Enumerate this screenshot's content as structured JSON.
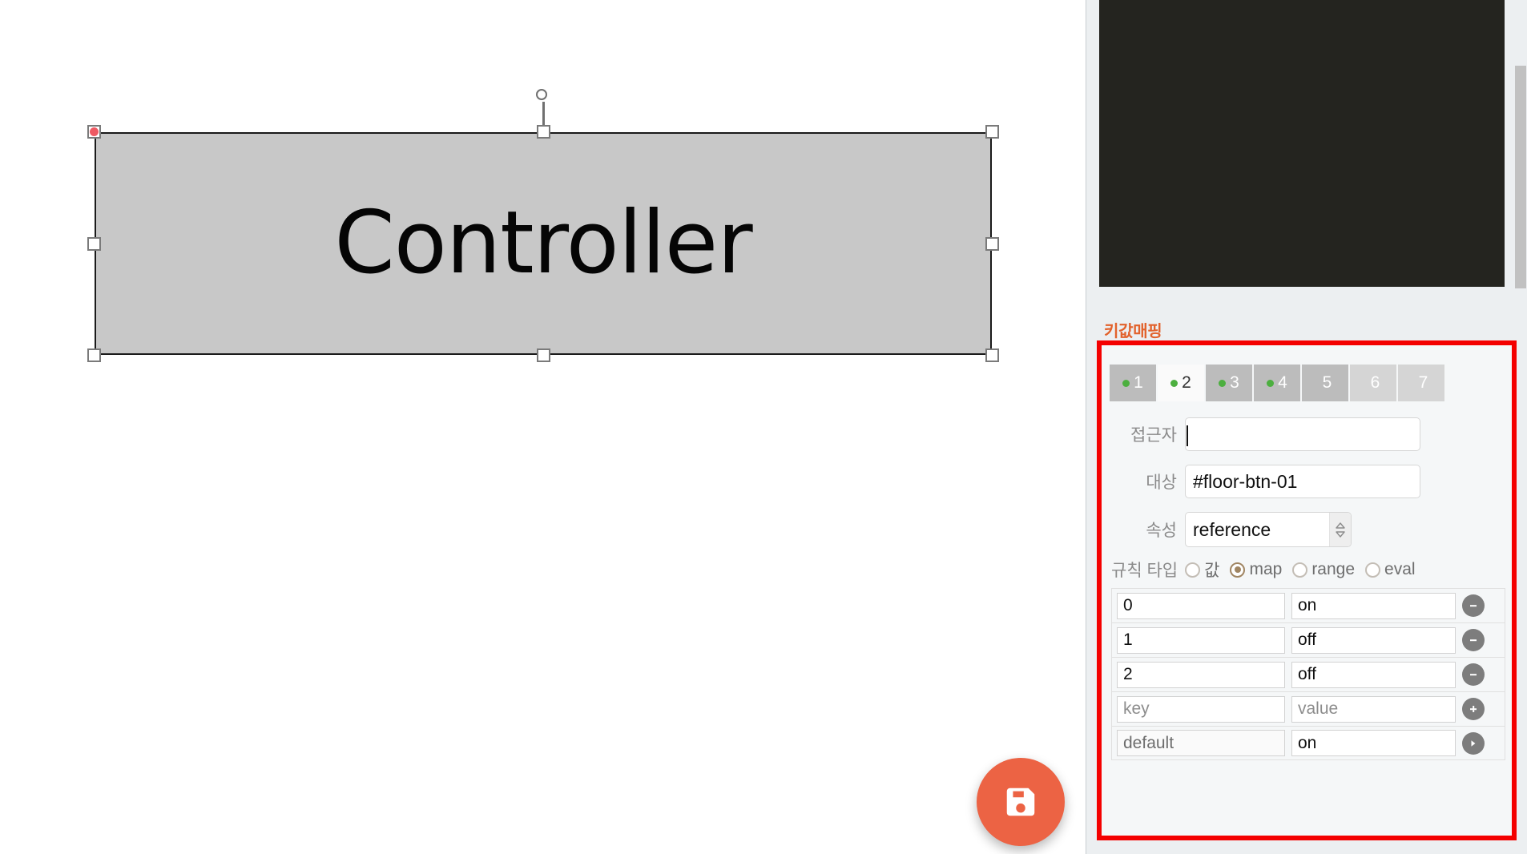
{
  "canvas": {
    "shape_label": "Controller",
    "shape_fill": "#c8c8c8",
    "shape_stroke": "#1a1a1a",
    "origin_handle_color": "#ef5a63"
  },
  "fab": {
    "icon": "save-floppy-icon",
    "color": "#ec6344"
  },
  "panel": {
    "preview_background": "#24241f",
    "section_title": "키값매핑",
    "section_title_color": "#e2622c",
    "annotation_color": "#f40000",
    "tabs": [
      {
        "label": "1",
        "has_dot": true,
        "active": false,
        "style": "filled"
      },
      {
        "label": "2",
        "has_dot": true,
        "active": true,
        "style": "active"
      },
      {
        "label": "3",
        "has_dot": true,
        "active": false,
        "style": "filled"
      },
      {
        "label": "4",
        "has_dot": true,
        "active": false,
        "style": "filled"
      },
      {
        "label": "5",
        "has_dot": false,
        "active": false,
        "style": "filled"
      },
      {
        "label": "6",
        "has_dot": false,
        "active": false,
        "style": "empty"
      },
      {
        "label": "7",
        "has_dot": false,
        "active": false,
        "style": "empty"
      }
    ],
    "tab_dot_color": "#4caf3f",
    "fields": {
      "accessor_label": "접근자",
      "accessor_value": "",
      "accessor_placeholder": "",
      "target_label": "대상",
      "target_value": "#floor-btn-01",
      "attribute_label": "속성",
      "attribute_value": "reference"
    },
    "rule_type": {
      "label": "규칙 타입",
      "selected": "map",
      "options": [
        {
          "label": "값",
          "selected": false
        },
        {
          "label": "map",
          "selected": true
        },
        {
          "label": "range",
          "selected": false
        },
        {
          "label": "eval",
          "selected": false
        }
      ],
      "selected_color": "#a08562"
    },
    "mapping_rows": [
      {
        "key": "0",
        "value": "on",
        "key_placeholder": "",
        "value_placeholder": "",
        "action": "remove",
        "readonly": false
      },
      {
        "key": "1",
        "value": "off",
        "key_placeholder": "",
        "value_placeholder": "",
        "action": "remove",
        "readonly": false
      },
      {
        "key": "2",
        "value": "off",
        "key_placeholder": "",
        "value_placeholder": "",
        "action": "remove",
        "readonly": false
      },
      {
        "key": "",
        "value": "",
        "key_placeholder": "key",
        "value_placeholder": "value",
        "action": "add",
        "readonly": false
      },
      {
        "key": "default",
        "value": "on",
        "key_placeholder": "",
        "value_placeholder": "",
        "action": "apply",
        "readonly": true
      }
    ]
  }
}
